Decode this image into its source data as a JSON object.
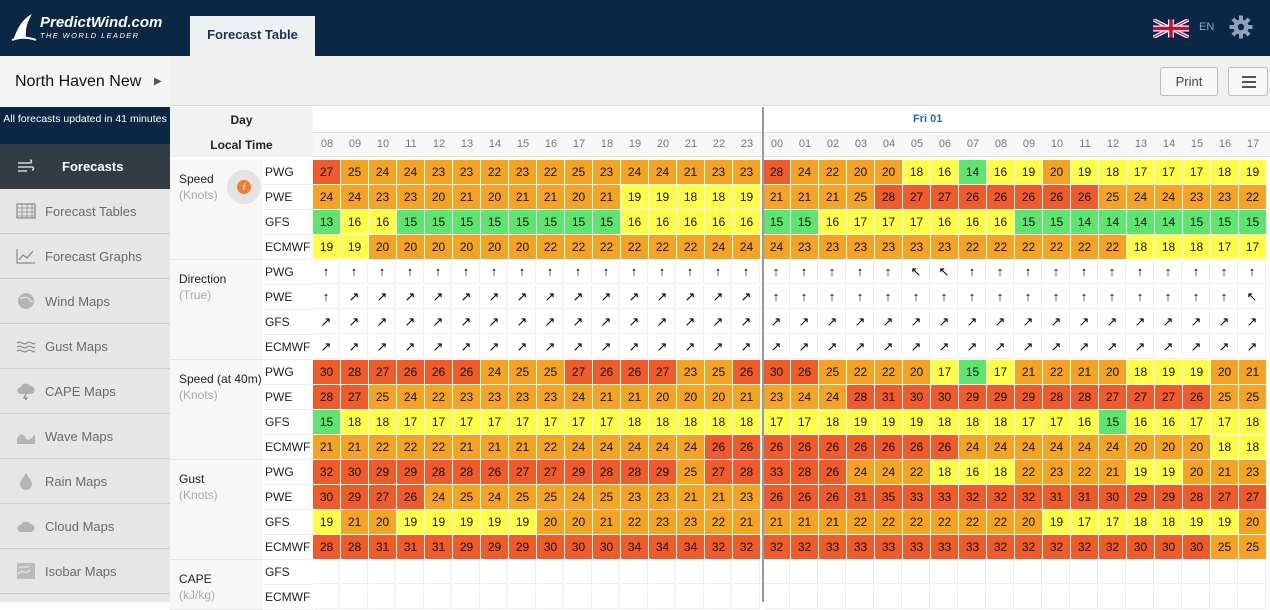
{
  "app": {
    "logo_title": "PredictWind.com",
    "logo_tagline": "THE WORLD LEADER",
    "active_tab": "Forecast Table",
    "language": "EN"
  },
  "sidebar": {
    "location": "North Haven New",
    "updated": "All forecasts updated in 41 minutes",
    "items": [
      {
        "label": "Forecasts",
        "icon": "wind-icon",
        "active": true
      },
      {
        "label": "Forecast Tables",
        "icon": "table-icon"
      },
      {
        "label": "Forecast Graphs",
        "icon": "line-graph-icon"
      },
      {
        "label": "Wind Maps",
        "icon": "globe-icon"
      },
      {
        "label": "Gust Maps",
        "icon": "gust-icon"
      },
      {
        "label": "CAPE Maps",
        "icon": "storm-cloud-icon"
      },
      {
        "label": "Wave Maps",
        "icon": "wave-icon"
      },
      {
        "label": "Rain Maps",
        "icon": "raindrop-icon"
      },
      {
        "label": "Cloud Maps",
        "icon": "cloud-icon"
      },
      {
        "label": "Isobar Maps",
        "icon": "isobar-icon"
      }
    ]
  },
  "toolbar": {
    "print_label": "Print"
  },
  "table": {
    "day_header": "Day",
    "time_header": "Local Time",
    "day2_label": "Fri 01",
    "hours": [
      "08",
      "09",
      "10",
      "11",
      "12",
      "13",
      "14",
      "15",
      "16",
      "17",
      "18",
      "19",
      "20",
      "21",
      "22",
      "23",
      "00",
      "01",
      "02",
      "03",
      "04",
      "05",
      "06",
      "07",
      "08",
      "09",
      "10",
      "11",
      "12",
      "13",
      "14",
      "15",
      "16",
      "17"
    ],
    "groups": [
      {
        "label": "Speed",
        "unit": "(Knots)",
        "rows": [
          {
            "model": "PWG",
            "values": [
              27,
              25,
              24,
              24,
              23,
              23,
              22,
              23,
              22,
              25,
              23,
              24,
              24,
              21,
              23,
              23,
              28,
              24,
              22,
              20,
              20,
              18,
              16,
              14,
              16,
              19,
              20,
              19,
              18,
              17,
              17,
              17,
              18,
              19
            ]
          },
          {
            "model": "PWE",
            "values": [
              24,
              24,
              23,
              23,
              20,
              21,
              20,
              21,
              21,
              20,
              21,
              19,
              19,
              18,
              18,
              19,
              21,
              21,
              21,
              25,
              28,
              27,
              27,
              26,
              26,
              26,
              26,
              26,
              25,
              24,
              24,
              23,
              23,
              22
            ]
          },
          {
            "model": "GFS",
            "values": [
              13,
              16,
              16,
              15,
              15,
              15,
              15,
              15,
              15,
              15,
              15,
              16,
              16,
              16,
              16,
              16,
              15,
              15,
              16,
              17,
              17,
              17,
              16,
              16,
              16,
              15,
              15,
              14,
              14,
              14,
              14,
              15,
              15,
              15
            ]
          },
          {
            "model": "ECMWF",
            "values": [
              19,
              19,
              20,
              20,
              20,
              20,
              20,
              20,
              22,
              22,
              22,
              22,
              22,
              22,
              24,
              24,
              24,
              23,
              23,
              23,
              23,
              23,
              23,
              22,
              22,
              22,
              22,
              22,
              22,
              18,
              18,
              18,
              17,
              17
            ]
          }
        ]
      },
      {
        "label": "Direction",
        "unit": "(True)",
        "rows": [
          {
            "model": "PWG",
            "values": [
              "↑",
              "↑",
              "↑",
              "↑",
              "↑",
              "↑",
              "↑",
              "↑",
              "↑",
              "↑",
              "↑",
              "↑",
              "↑",
              "↑",
              "↑",
              "↑",
              "↑",
              "↑",
              "↑",
              "↑",
              "↑",
              "↖",
              "↖",
              "↑",
              "↑",
              "↑",
              "↑",
              "↑",
              "↑",
              "↑",
              "↑",
              "↑",
              "↑",
              "↑"
            ]
          },
          {
            "model": "PWE",
            "values": [
              "↑",
              "↗",
              "↗",
              "↗",
              "↗",
              "↗",
              "↗",
              "↗",
              "↗",
              "↗",
              "↗",
              "↗",
              "↗",
              "↗",
              "↗",
              "↗",
              "↑",
              "↑",
              "↑",
              "↑",
              "↑",
              "↑",
              "↑",
              "↑",
              "↑",
              "↑",
              "↑",
              "↑",
              "↑",
              "↑",
              "↑",
              "↑",
              "↑",
              "↖"
            ]
          },
          {
            "model": "GFS",
            "values": [
              "↗",
              "↗",
              "↗",
              "↗",
              "↗",
              "↗",
              "↗",
              "↗",
              "↗",
              "↗",
              "↗",
              "↗",
              "↗",
              "↗",
              "↗",
              "↗",
              "↗",
              "↗",
              "↗",
              "↗",
              "↗",
              "↗",
              "↗",
              "↗",
              "↗",
              "↗",
              "↗",
              "↗",
              "↗",
              "↗",
              "↗",
              "↗",
              "↗",
              "↗"
            ]
          },
          {
            "model": "ECMWF",
            "values": [
              "↗",
              "↗",
              "↗",
              "↗",
              "↗",
              "↗",
              "↗",
              "↗",
              "↗",
              "↗",
              "↗",
              "↗",
              "↗",
              "↗",
              "↗",
              "↗",
              "↗",
              "↗",
              "↗",
              "↗",
              "↗",
              "↗",
              "↗",
              "↗",
              "↗",
              "↗",
              "↗",
              "↗",
              "↗",
              "↗",
              "↗",
              "↗",
              "↗",
              "↗"
            ]
          }
        ]
      },
      {
        "label": "Speed (at 40m)",
        "unit": "(Knots)",
        "rows": [
          {
            "model": "PWG",
            "values": [
              30,
              28,
              27,
              26,
              26,
              26,
              24,
              25,
              25,
              27,
              26,
              26,
              27,
              23,
              25,
              26,
              30,
              26,
              25,
              22,
              22,
              20,
              17,
              15,
              17,
              21,
              22,
              21,
              20,
              18,
              19,
              19,
              20,
              21
            ]
          },
          {
            "model": "PWE",
            "values": [
              28,
              27,
              25,
              24,
              22,
              23,
              23,
              23,
              23,
              24,
              21,
              21,
              20,
              20,
              20,
              21,
              23,
              24,
              24,
              28,
              31,
              30,
              30,
              29,
              29,
              29,
              28,
              28,
              27,
              27,
              27,
              26,
              25,
              25
            ]
          },
          {
            "model": "GFS",
            "values": [
              15,
              18,
              18,
              17,
              17,
              17,
              17,
              17,
              17,
              17,
              17,
              18,
              18,
              18,
              18,
              18,
              17,
              17,
              18,
              19,
              19,
              19,
              18,
              18,
              18,
              17,
              17,
              16,
              15,
              16,
              16,
              17,
              17,
              18
            ]
          },
          {
            "model": "ECMWF",
            "values": [
              21,
              21,
              22,
              22,
              22,
              21,
              21,
              21,
              22,
              24,
              24,
              24,
              24,
              24,
              26,
              26,
              26,
              26,
              26,
              26,
              26,
              26,
              26,
              24,
              24,
              24,
              24,
              24,
              24,
              20,
              20,
              20,
              18,
              18
            ]
          }
        ]
      },
      {
        "label": "Gust",
        "unit": "(Knots)",
        "rows": [
          {
            "model": "PWG",
            "values": [
              32,
              30,
              29,
              29,
              28,
              28,
              26,
              27,
              27,
              29,
              28,
              28,
              29,
              25,
              27,
              28,
              33,
              28,
              26,
              24,
              24,
              22,
              18,
              16,
              18,
              22,
              23,
              22,
              21,
              19,
              19,
              20,
              21,
              23
            ]
          },
          {
            "model": "PWE",
            "values": [
              30,
              29,
              27,
              26,
              24,
              25,
              24,
              25,
              25,
              24,
              25,
              23,
              23,
              21,
              21,
              23,
              26,
              26,
              26,
              31,
              35,
              33,
              33,
              32,
              32,
              32,
              31,
              31,
              30,
              29,
              29,
              28,
              27,
              27
            ]
          },
          {
            "model": "GFS",
            "values": [
              19,
              21,
              20,
              19,
              19,
              19,
              19,
              19,
              20,
              20,
              21,
              22,
              23,
              23,
              22,
              21,
              21,
              21,
              21,
              22,
              22,
              22,
              22,
              22,
              22,
              20,
              19,
              17,
              17,
              18,
              18,
              19,
              19,
              20
            ]
          },
          {
            "model": "ECMWF",
            "values": [
              28,
              28,
              31,
              31,
              31,
              29,
              29,
              29,
              30,
              30,
              30,
              34,
              34,
              34,
              32,
              32,
              32,
              32,
              33,
              33,
              33,
              33,
              33,
              33,
              32,
              32,
              32,
              32,
              32,
              30,
              30,
              30,
              25,
              25
            ]
          }
        ]
      },
      {
        "label": "CAPE",
        "unit": "(kJ/kg)",
        "rows": [
          {
            "model": "GFS",
            "values": []
          },
          {
            "model": "ECMWF",
            "values": []
          }
        ]
      }
    ],
    "colors": {
      "green": "#5ee56f",
      "yellow": "#ffff4a",
      "orange": "#f5a325",
      "red": "#ef5b2a"
    }
  }
}
